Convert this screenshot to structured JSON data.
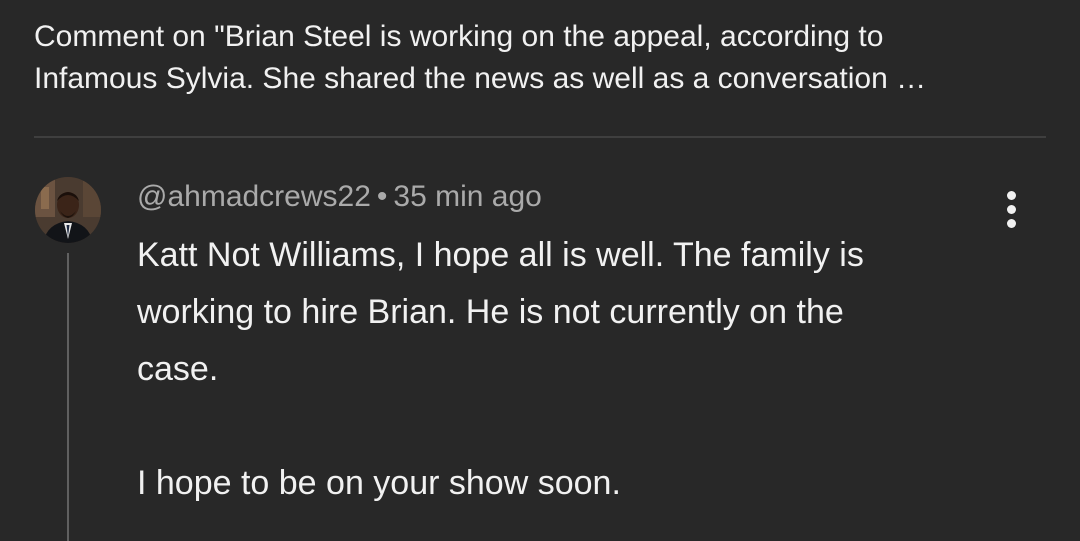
{
  "header": {
    "line1": "Comment on \"Brian Steel is working on the appeal, according to",
    "line2": "Infamous Sylvia. She shared the news as well as a conversation …"
  },
  "comment": {
    "author": "@ahmadcrews22",
    "separator": "•",
    "time": "35 min ago",
    "paragraph1_lines": [
      "Katt Not Williams, I hope all is well. The family is",
      "working to hire Brian. He is not currently on the",
      "case."
    ],
    "paragraph2": "I hope to be on your show soon.",
    "menu_icon": "more-vert-icon",
    "avatar_icon": "user-avatar"
  },
  "colors": {
    "background": "#282828",
    "text_primary": "#f1f1f1",
    "text_secondary": "#aaaaaa",
    "divider": "#3f3f3f",
    "thread_line": "#606060"
  }
}
